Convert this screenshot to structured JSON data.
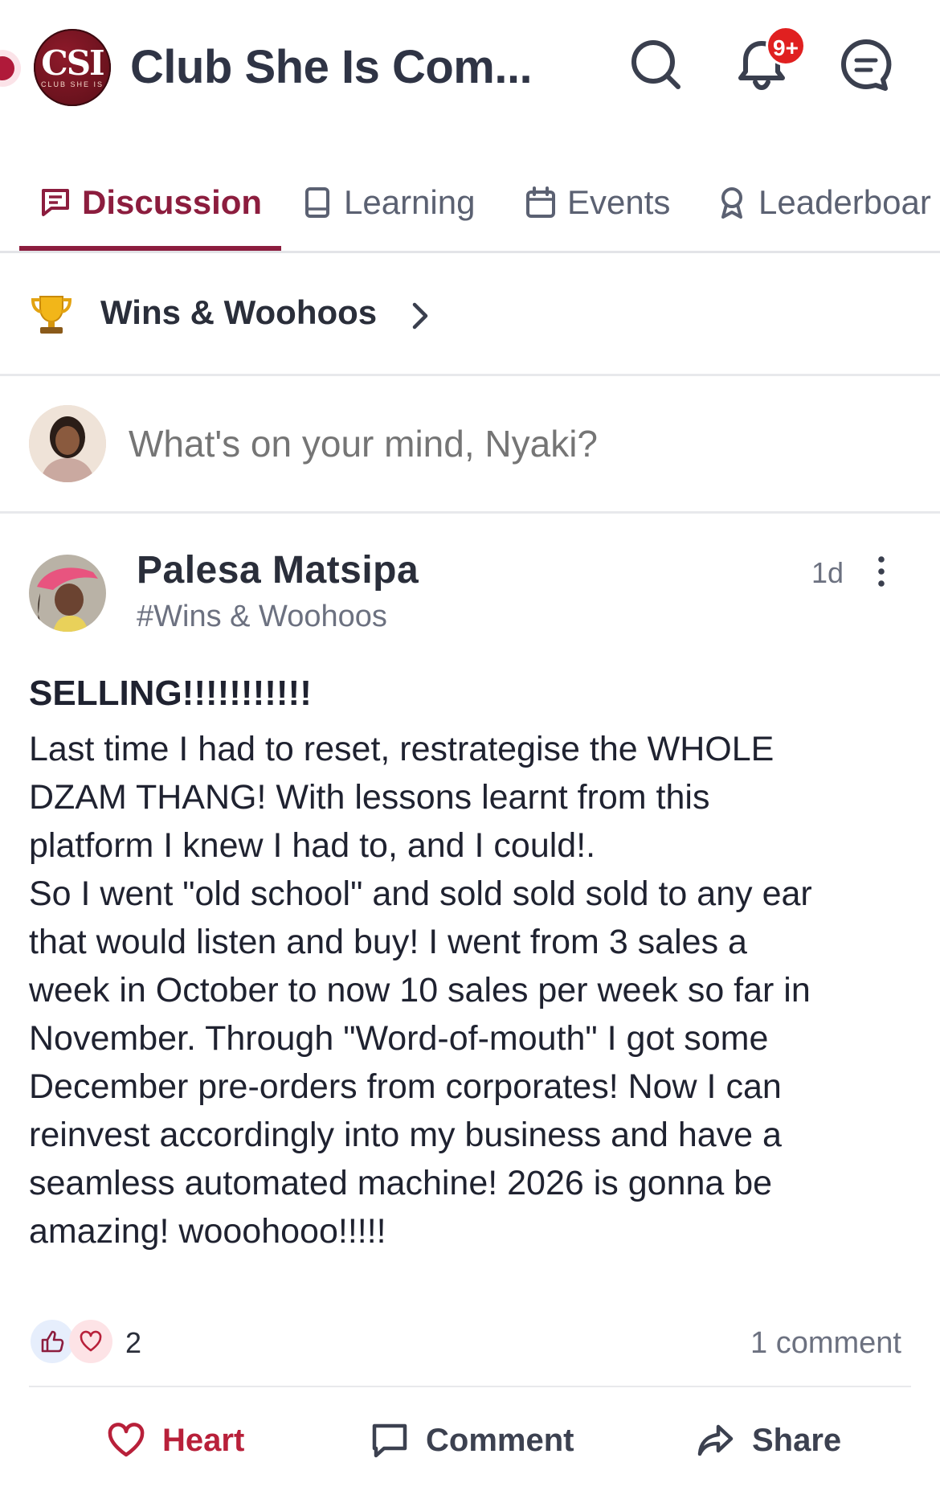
{
  "header": {
    "title": "Club She Is Com...",
    "logo_text": "CSI",
    "logo_subtext": "CLUB SHE IS",
    "notification_badge": "9+",
    "icons": [
      "search-icon",
      "bell-icon",
      "chat-icon"
    ]
  },
  "tabs": [
    {
      "label": "Discussion",
      "icon": "discussion-icon",
      "active": true
    },
    {
      "label": "Learning",
      "icon": "book-icon",
      "active": false
    },
    {
      "label": "Events",
      "icon": "calendar-icon",
      "active": false
    },
    {
      "label": "Leaderboar",
      "icon": "award-icon",
      "active": false
    }
  ],
  "category": {
    "label": "Wins & Woohoos",
    "icon": "trophy-icon"
  },
  "composer": {
    "placeholder": "What's on your mind, Nyaki?"
  },
  "post": {
    "author": "Palesa Matsipa",
    "channel": "#Wins & Woohoos",
    "time": "1d",
    "title": "SELLING!!!!!!!!!!!",
    "body": "Last time I had to reset, restrategise the WHOLE\nDZAM THANG! With lessons learnt from this\nplatform I knew I had to, and I could!.\nSo I went \"old school\" and sold sold sold to any ear\nthat would listen and buy! I went from 3 sales a\nweek in October to now 10 sales per week so far in\nNovember. Through \"Word-of-mouth\" I got some\nDecember pre-orders from corporates! Now I can\nreinvest accordingly into my business and have a\nseamless automated machine! 2026 is gonna be\namazing! wooohooo!!!!!",
    "reactions_count": "2",
    "comments_label": "1 comment"
  },
  "actions": {
    "heart": "Heart",
    "comment": "Comment",
    "share": "Share"
  },
  "colors": {
    "accent": "#8c1d3e",
    "heart": "#b8203a",
    "badge": "#e02020"
  }
}
